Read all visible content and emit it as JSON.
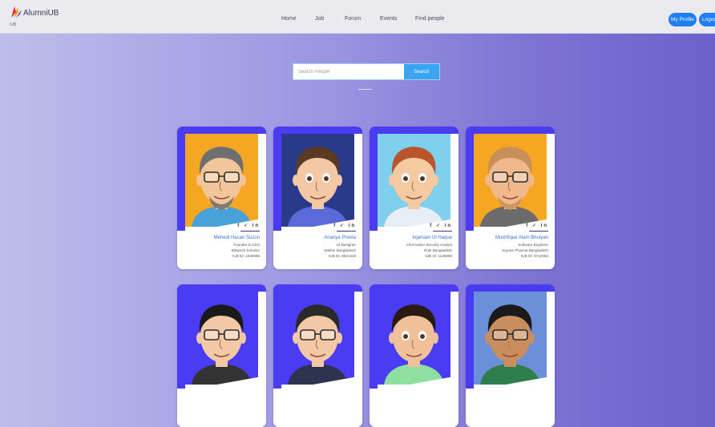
{
  "brand": {
    "name": "AlumniUB",
    "sub": "IUB"
  },
  "nav": {
    "links": [
      "Home",
      "Job",
      "Forum",
      "Events",
      "Find people"
    ],
    "profile_label": "My Profile",
    "logout_label": "Logout"
  },
  "search": {
    "placeholder": "Search People",
    "button_label": "Search"
  },
  "social_icons": "f ✓ in",
  "colors": {
    "accent": "#4a3cf2",
    "button": "#1e7ef2",
    "search_button": "#3aa4f0",
    "name": "#3a6fd8"
  },
  "people": [
    {
      "name": "Mehedi Hasan Suzon",
      "role": "Founder & CEO",
      "company": "Bitspeck Solution",
      "id": "IUB ID: 1530089",
      "photo_bg": "#f5a623",
      "skin": "#f3c59a",
      "hair": "#6f6f6f",
      "glasses": true,
      "beard": true,
      "shirt": "#4aa0d8"
    },
    {
      "name": "Ananya Preeta",
      "role": "UI Designer",
      "company": "Walton Bangladesh",
      "id": "IUB ID: 9921318",
      "photo_bg": "#2a3a8a",
      "skin": "#f4c7a5",
      "hair": "#5b3a22",
      "glasses": false,
      "beard": false,
      "shirt": "#5a6ad8"
    },
    {
      "name": "Injamam Ul Haque",
      "role": "Information Security Analyst",
      "company": "Robi Bangladesh",
      "id": "IUB ID: 1136996",
      "photo_bg": "#7ed0ec",
      "skin": "#f5caa3",
      "hair": "#b8552d",
      "glasses": false,
      "beard": false,
      "shirt": "#e8eef5"
    },
    {
      "name": "Mushfique Alam Bhuiyan",
      "role": "Software Engineer",
      "company": "Square Pharma Bangladesh",
      "id": "IUB ID: 9710053",
      "photo_bg": "#f5a623",
      "skin": "#f0b98c",
      "hair": "#c98f5a",
      "glasses": true,
      "beard": true,
      "shirt": "#6b6b6b"
    },
    {
      "name": "",
      "role": "",
      "company": "",
      "id": "",
      "photo_bg": "#4a3cf2",
      "skin": "#f3c8a4",
      "hair": "#1a1a1a",
      "glasses": true,
      "beard": false,
      "shirt": "#333333"
    },
    {
      "name": "",
      "role": "",
      "company": "",
      "id": "",
      "photo_bg": "#4a3cf2",
      "skin": "#f3c8a4",
      "hair": "#2a2a2a",
      "glasses": true,
      "beard": false,
      "shirt": "#2e3350"
    },
    {
      "name": "",
      "role": "",
      "company": "",
      "id": "",
      "photo_bg": "#4a3cf2",
      "skin": "#f0c09b",
      "hair": "#2a1a12",
      "glasses": false,
      "beard": false,
      "shirt": "#8fe0a0"
    },
    {
      "name": "",
      "role": "",
      "company": "",
      "id": "",
      "photo_bg": "#6b8fd8",
      "skin": "#c98d5e",
      "hair": "#1a1a1a",
      "glasses": true,
      "beard": false,
      "shirt": "#2e7d4a"
    }
  ]
}
